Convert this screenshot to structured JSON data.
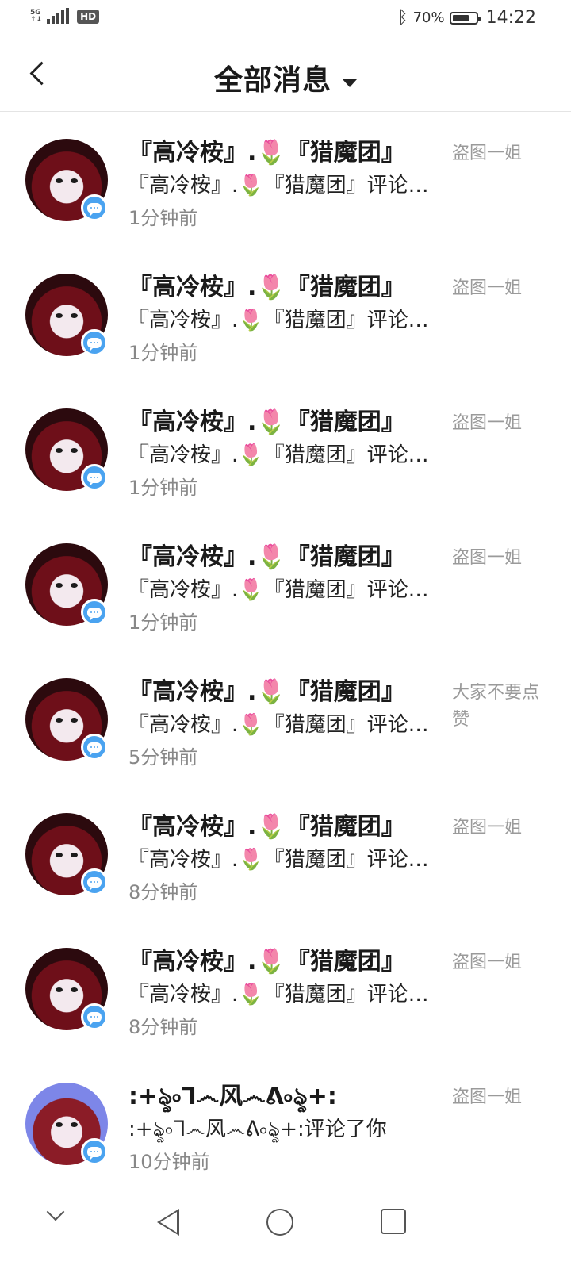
{
  "status_bar": {
    "network": "5G",
    "hd": "HD",
    "battery_text": "70%",
    "battery_level": 0.7,
    "time": "14:22"
  },
  "header": {
    "title": "全部消息"
  },
  "messages": [
    {
      "name": "『高冷桉』.🌷『猎魔团』",
      "preview": "『高冷桉』.🌷『猎魔团』评论了你",
      "time": "1分钟前",
      "note": "盗图一姐"
    },
    {
      "name": "『高冷桉』.🌷『猎魔团』",
      "preview": "『高冷桉』.🌷『猎魔团』评论了你",
      "time": "1分钟前",
      "note": "盗图一姐"
    },
    {
      "name": "『高冷桉』.🌷『猎魔团』",
      "preview": "『高冷桉』.🌷『猎魔团』评论了你",
      "time": "1分钟前",
      "note": "盗图一姐"
    },
    {
      "name": "『高冷桉』.🌷『猎魔团』",
      "preview": "『高冷桉』.🌷『猎魔团』评论了你",
      "time": "1分钟前",
      "note": "盗图一姐"
    },
    {
      "name": "『高冷桉』.🌷『猎魔团』",
      "preview": "『高冷桉』.🌷『猎魔团』评论了你",
      "time": "5分钟前",
      "note": "大家不要点赞"
    },
    {
      "name": "『高冷桉』.🌷『猎魔团』",
      "preview": "『高冷桉』.🌷『猎魔团』评论了你",
      "time": "8分钟前",
      "note": "盗图一姐"
    },
    {
      "name": "『高冷桉』.🌷『猎魔团』",
      "preview": "『高冷桉』.🌷『猎魔团』评论了你",
      "time": "8分钟前",
      "note": "盗图一姐"
    },
    {
      "name": ":+ৡ৹ᒣ෴风෴ᕕ৹ৡ+:",
      "preview": ":+ৡ৹ᒣ෴风෴ᕕ৹ৡ+:评论了你",
      "time": "10分钟前",
      "note": "盗图一姐"
    }
  ]
}
